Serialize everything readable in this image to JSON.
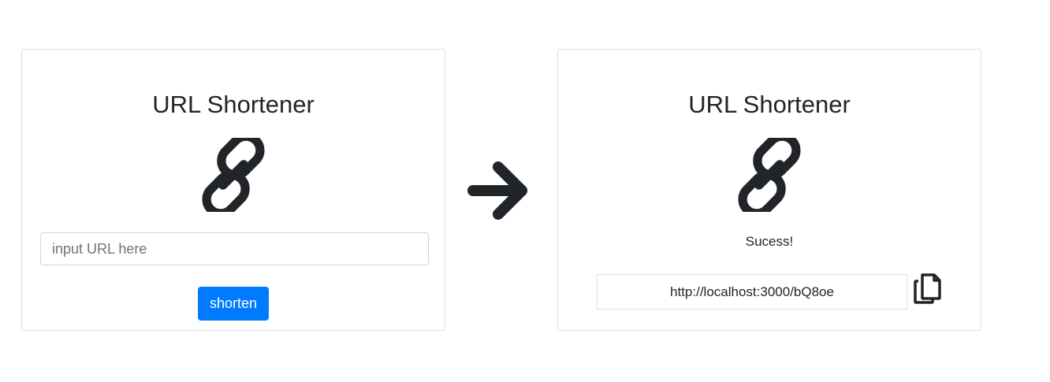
{
  "left_card": {
    "title": "URL Shortener",
    "icon": "link-icon",
    "input": {
      "placeholder": "input URL here",
      "value": ""
    },
    "button_label": "shorten"
  },
  "arrow_icon": "arrow-right-icon",
  "right_card": {
    "title": "URL Shortener",
    "icon": "link-icon",
    "status": "Sucess!",
    "short_url": "http://localhost:3000/bQ8oe",
    "copy_icon": "copy-icon"
  },
  "colors": {
    "primary_button": "#007bff",
    "text": "#212529",
    "card_border": "#dfe1e4",
    "icon": "#212529"
  }
}
